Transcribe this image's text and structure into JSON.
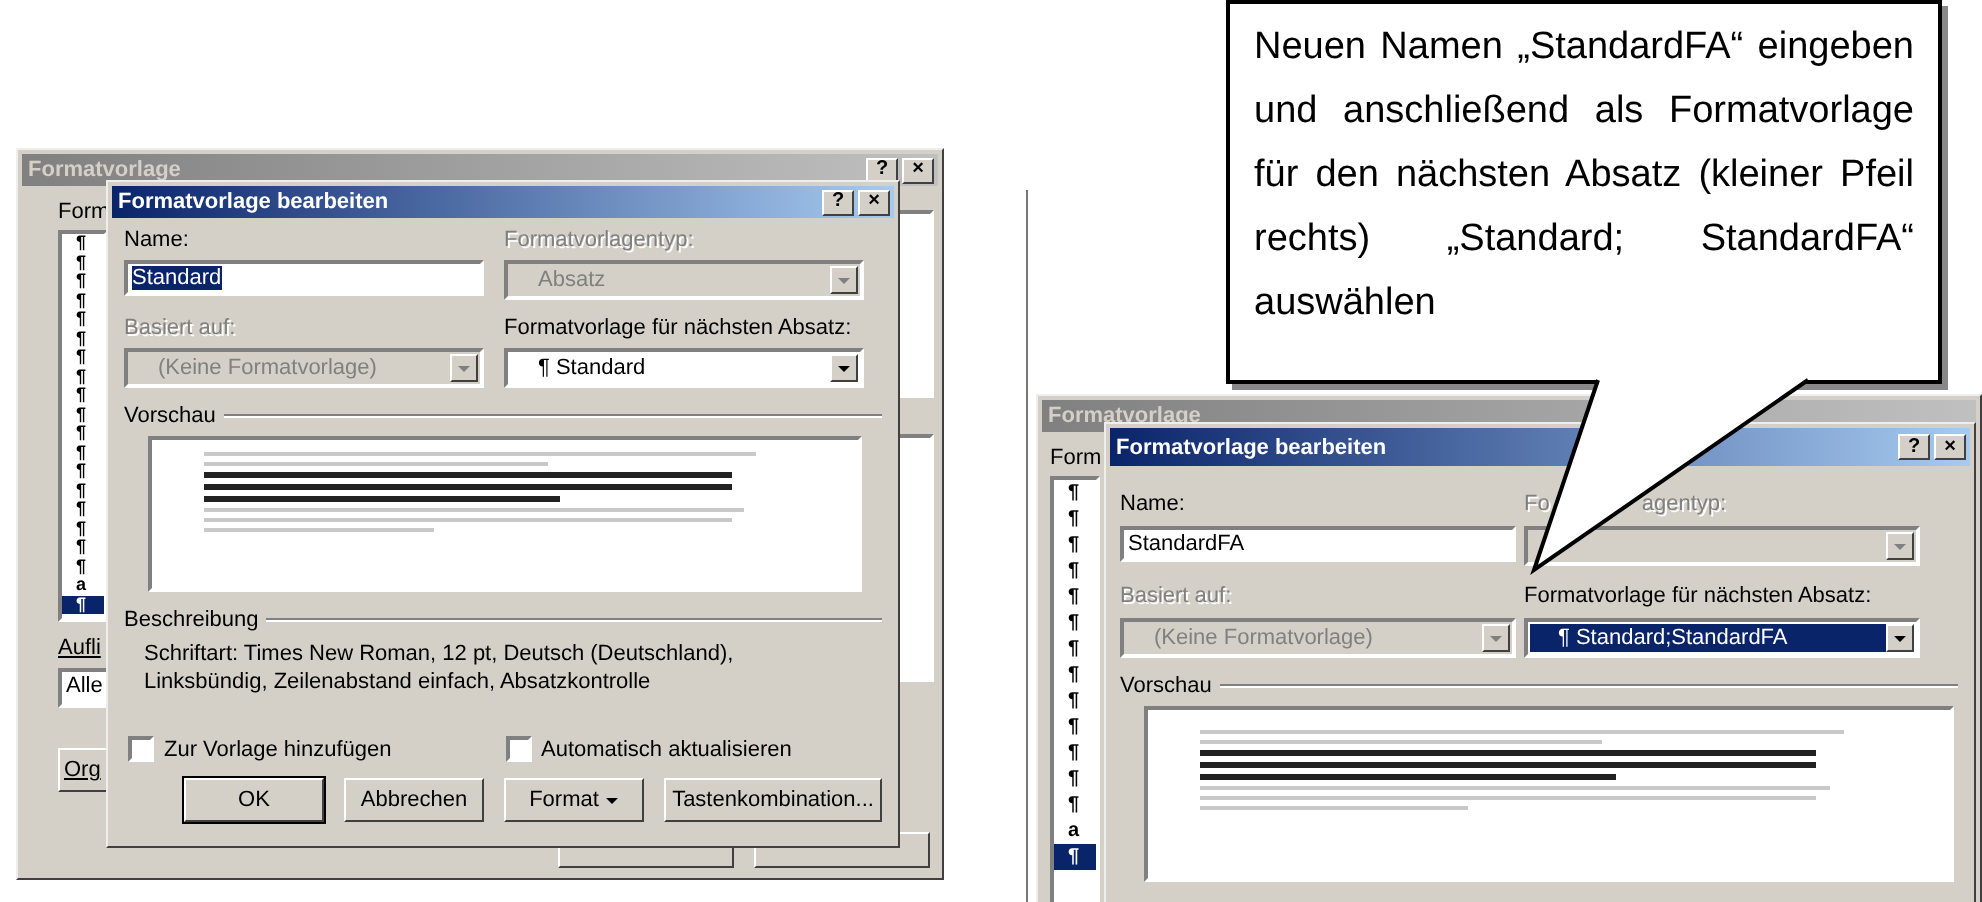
{
  "left_screenshot": {
    "back_window": {
      "title": "Formatvorlage",
      "title_buttons": [
        "?",
        "×"
      ],
      "list_label": "Form",
      "list_items": [
        {
          "mark": "¶",
          "selected": false
        },
        {
          "mark": "¶",
          "selected": false
        },
        {
          "mark": "¶",
          "selected": false
        },
        {
          "mark": "¶",
          "selected": false
        },
        {
          "mark": "¶",
          "selected": false
        },
        {
          "mark": "¶",
          "selected": false
        },
        {
          "mark": "¶",
          "selected": false
        },
        {
          "mark": "¶",
          "selected": false
        },
        {
          "mark": "¶",
          "selected": false
        },
        {
          "mark": "¶",
          "selected": false
        },
        {
          "mark": "¶",
          "selected": false
        },
        {
          "mark": "¶",
          "selected": false
        },
        {
          "mark": "¶",
          "selected": false
        },
        {
          "mark": "¶",
          "selected": false
        },
        {
          "mark": "¶",
          "selected": false
        },
        {
          "mark": "¶",
          "selected": false
        },
        {
          "mark": "¶",
          "selected": false
        },
        {
          "mark": "¶",
          "selected": false
        },
        {
          "mark": "a",
          "selected": false
        },
        {
          "mark": "¶",
          "selected": true
        }
      ],
      "filter_label": "Aufli",
      "filter_value": "Alle",
      "side_button": "Org"
    },
    "dialog": {
      "title": "Formatvorlage bearbeiten",
      "title_buttons": [
        "?",
        "×"
      ],
      "name": {
        "label": "Name:",
        "value": "Standard",
        "selected": true
      },
      "style_type": {
        "label": "Formatvorlagentyp:",
        "value": "Absatz",
        "disabled": true
      },
      "based_on": {
        "label": "Basiert auf:",
        "value": "(Keine Formatvorlage)",
        "disabled": true
      },
      "next_style": {
        "label": "Formatvorlage für nächsten Absatz:",
        "value": "¶ Standard",
        "disabled": false,
        "selected": false
      },
      "preview": {
        "label": "Vorschau"
      },
      "description": {
        "label": "Beschreibung",
        "text": "Schriftart: Times New Roman, 12 pt, Deutsch (Deutschland), Linksbündig, Zeilenabstand einfach, Absatzkontrolle"
      },
      "checkboxes": [
        {
          "label": "Zur Vorlage hinzufügen",
          "checked": false
        },
        {
          "label": "Automatisch aktualisieren",
          "checked": false
        }
      ],
      "buttons": [
        {
          "label": "OK",
          "default": true,
          "dropdown": false
        },
        {
          "label": "Abbrechen",
          "default": false,
          "dropdown": false
        },
        {
          "label": "Format",
          "default": false,
          "dropdown": true
        },
        {
          "label": "Tastenkombination...",
          "default": false,
          "dropdown": false
        }
      ]
    }
  },
  "right_screenshot": {
    "back_window": {
      "title": "Formatvorlage",
      "list_label": "Form",
      "list_items": [
        {
          "mark": "¶",
          "selected": false
        },
        {
          "mark": "¶",
          "selected": false
        },
        {
          "mark": "¶",
          "selected": false
        },
        {
          "mark": "¶",
          "selected": false
        },
        {
          "mark": "¶",
          "selected": false
        },
        {
          "mark": "¶",
          "selected": false
        },
        {
          "mark": "¶",
          "selected": false
        },
        {
          "mark": "¶",
          "selected": false
        },
        {
          "mark": "¶",
          "selected": false
        },
        {
          "mark": "¶",
          "selected": false
        },
        {
          "mark": "¶",
          "selected": false
        },
        {
          "mark": "¶",
          "selected": false
        },
        {
          "mark": "¶",
          "selected": false
        },
        {
          "mark": "a",
          "selected": false
        },
        {
          "mark": "¶",
          "selected": true
        }
      ]
    },
    "dialog": {
      "title": "Formatvorlage bearbeiten",
      "title_buttons": [
        "?",
        "×"
      ],
      "name": {
        "label": "Name:",
        "value": "StandardFA",
        "selected": false
      },
      "style_type": {
        "label_parts": [
          "Fo",
          "agentyp:"
        ],
        "disabled": true
      },
      "based_on": {
        "label": "Basiert auf:",
        "value": "(Keine Formatvorlage)",
        "disabled": true
      },
      "next_style": {
        "label": "Formatvorlage für nächsten Absatz:",
        "value": "¶ Standard;StandardFA",
        "disabled": false,
        "selected": true
      },
      "preview": {
        "label": "Vorschau"
      }
    }
  },
  "callout": {
    "text": "Neuen Namen „StandardFA“ eingeben und anschließend als Formatvorlage für den nächsten Absatz (kleiner Pfeil rechts) „Standard; StandardFA“ auswählen"
  }
}
